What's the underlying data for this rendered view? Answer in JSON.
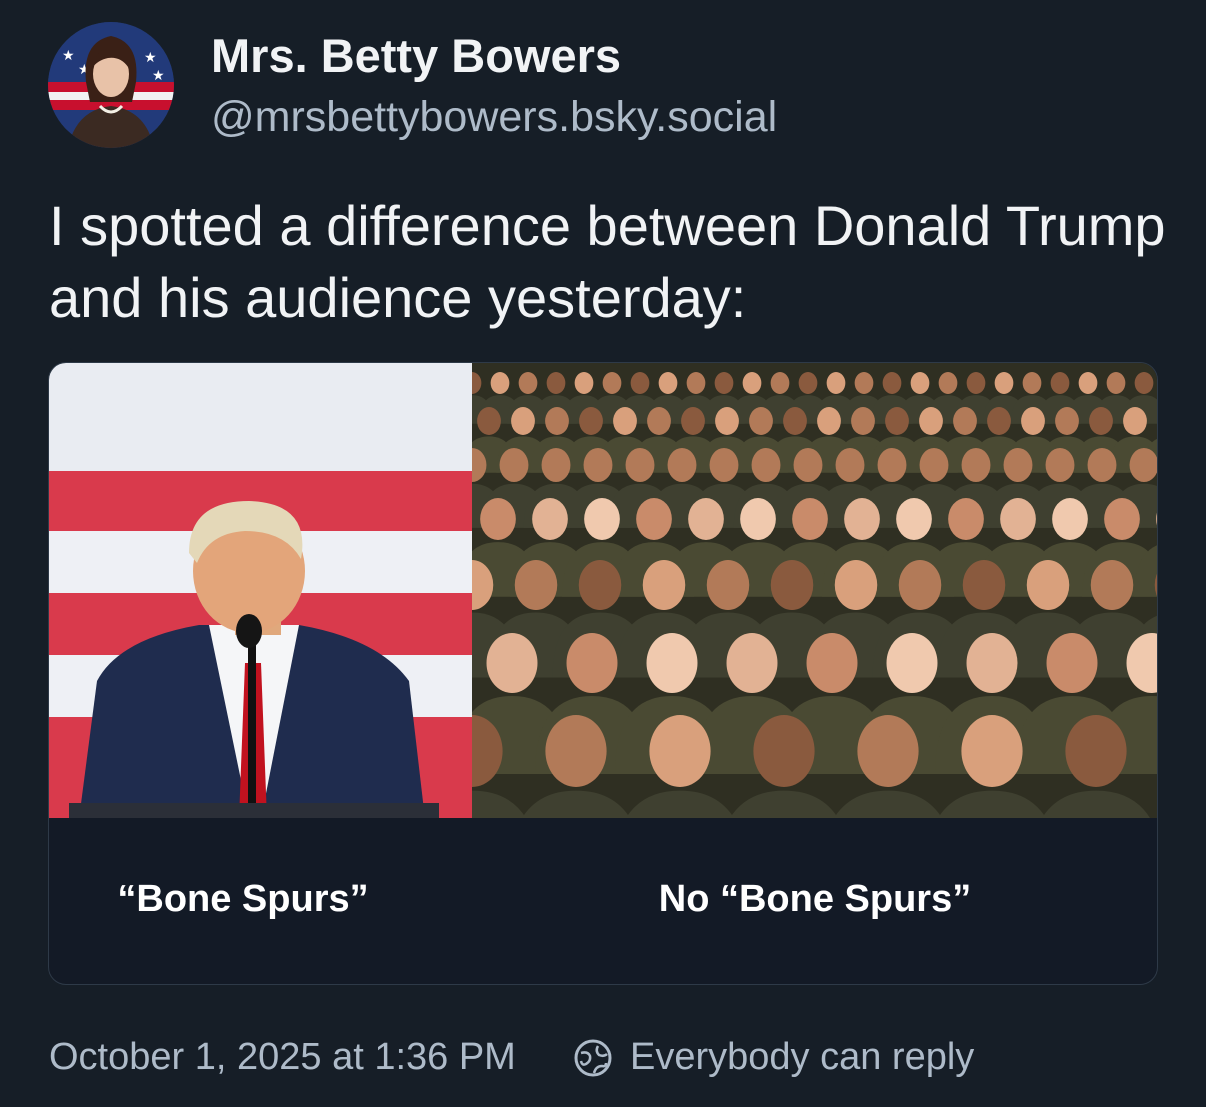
{
  "author": {
    "display_name": "Mrs. Betty Bowers",
    "handle": "@mrsbettybowers.bsky.social"
  },
  "post": {
    "text": "I spotted a difference between Donald Trump and his audience yesterday:"
  },
  "embed": {
    "caption_left": "“Bone Spurs”",
    "caption_right": "No “Bone Spurs”"
  },
  "meta": {
    "timestamp": "October 1, 2025 at 1:36 PM",
    "reply_setting": "Everybody can reply",
    "reply_icon": "globe-icon"
  },
  "colors": {
    "background": "#161e27",
    "text_primary": "#f1f3f5",
    "text_secondary": "#aebbc9",
    "card_background": "#131a26",
    "card_border": "#2e3a48"
  }
}
